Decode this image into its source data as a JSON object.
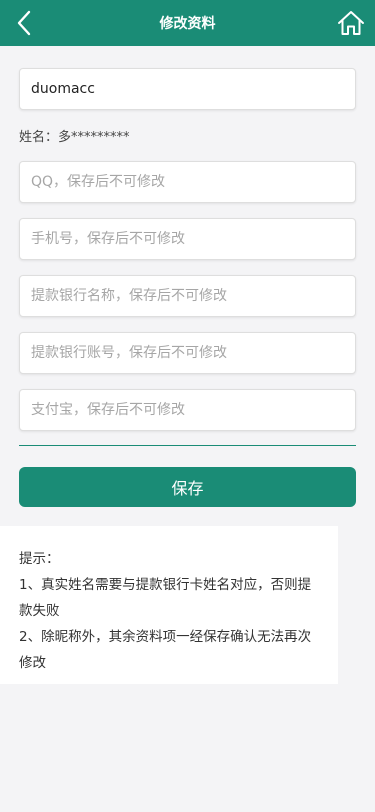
{
  "header": {
    "title": "修改资料",
    "back_icon": "chevron-left-icon",
    "home_icon": "home-icon"
  },
  "form": {
    "nickname_value": "duomacc",
    "name_label": "姓名：",
    "name_value": "多*********",
    "qq_placeholder": "QQ，保存后不可修改",
    "phone_placeholder": "手机号，保存后不可修改",
    "bank_name_placeholder": "提款银行名称，保存后不可修改",
    "bank_account_placeholder": "提款银行账号，保存后不可修改",
    "alipay_placeholder": "支付宝，保存后不可修改",
    "save_label": "保存"
  },
  "tips": {
    "title": "提示：",
    "line1": "1、真实姓名需要与提款银行卡姓名对应，否则提款失败",
    "line2": "2、除昵称外，其余资料项一经保存确认无法再次修改"
  },
  "colors": {
    "accent": "#1a8c76",
    "background": "#f4f4f6"
  }
}
